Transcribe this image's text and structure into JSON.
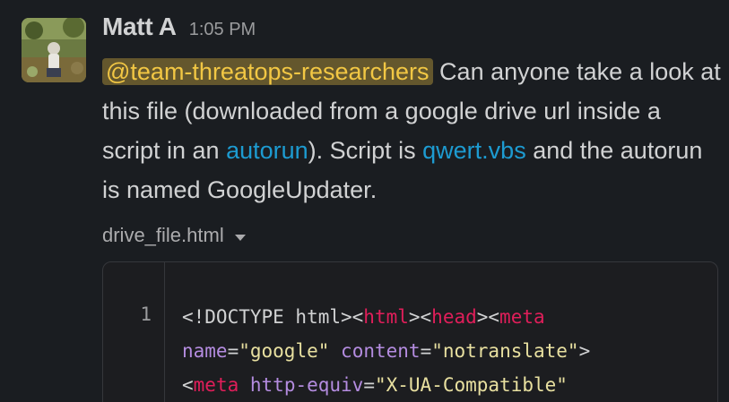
{
  "message": {
    "author": "Matt A",
    "timestamp": "1:05 PM",
    "avatar_icon": "user-photo-avatar",
    "mention": "@team-threatops-researchers",
    "text_after_mention": " Can anyone take a look at this file (downloaded from a google drive url inside a script in an ",
    "link_autorun": "autorun",
    "text_middle": "). Script is ",
    "link_script": "qwert.vbs",
    "text_end": " and the autorun is named GoogleUpdater."
  },
  "file": {
    "name": "drive_file.html",
    "caret_icon": "chevron-down-icon",
    "line_number": "1",
    "code_lines": [
      [
        {
          "t": "plain",
          "v": "<!DOCTYPE html><"
        },
        {
          "t": "tag",
          "v": "html"
        },
        {
          "t": "plain",
          "v": "><"
        },
        {
          "t": "tag",
          "v": "head"
        },
        {
          "t": "plain",
          "v": "><"
        },
        {
          "t": "tag",
          "v": "meta"
        }
      ],
      [
        {
          "t": "attr",
          "v": "name"
        },
        {
          "t": "plain",
          "v": "="
        },
        {
          "t": "str",
          "v": "\"google\""
        },
        {
          "t": "plain",
          "v": " "
        },
        {
          "t": "attr",
          "v": "content"
        },
        {
          "t": "plain",
          "v": "="
        },
        {
          "t": "str",
          "v": "\"notranslate\""
        },
        {
          "t": "plain",
          "v": ">"
        }
      ],
      [
        {
          "t": "plain",
          "v": "<"
        },
        {
          "t": "tag",
          "v": "meta"
        },
        {
          "t": "plain",
          "v": " "
        },
        {
          "t": "attr",
          "v": "http-equiv"
        },
        {
          "t": "plain",
          "v": "="
        },
        {
          "t": "str",
          "v": "\"X-UA-Compatible\""
        }
      ]
    ]
  },
  "colors": {
    "background": "#1a1d21",
    "mention_text": "#f2c744",
    "link": "#1d9bd1",
    "code_tag": "#e01e5a",
    "code_attr": "#b48ce0",
    "code_string": "#e8e0a0"
  }
}
